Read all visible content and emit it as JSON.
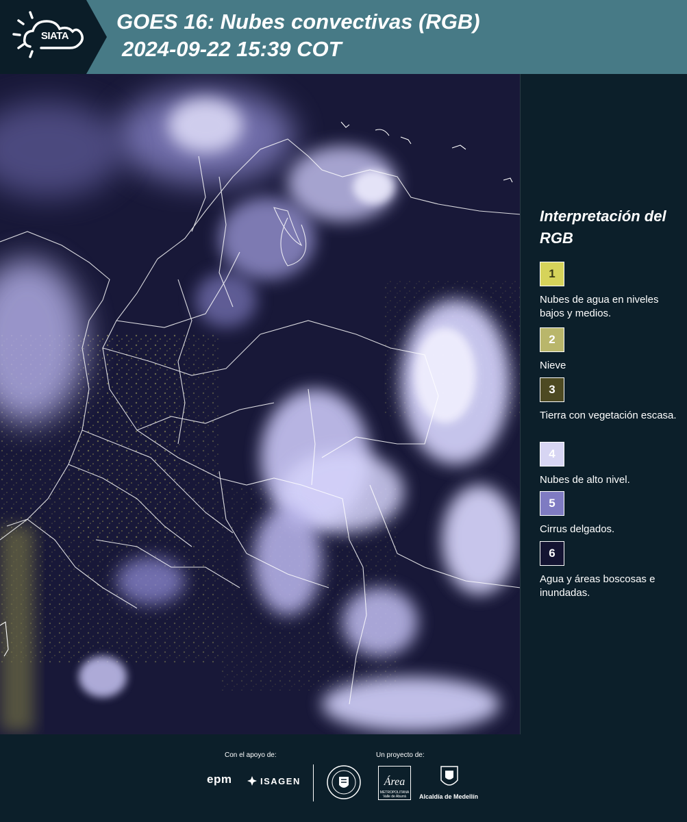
{
  "header": {
    "logo_text": "SIATA",
    "title_line1": "GOES 16: Nubes convectivas (RGB)",
    "title_line2": "2024-09-22 15:39 COT"
  },
  "map": {
    "layer": "Nubes convectivas (RGB)",
    "colors": {
      "background": "#181838",
      "high_cloud": "#c9c6f5",
      "cloud_core": "#ecebff",
      "low_cloud": "#b7b366",
      "boundaries": "#ffffff"
    }
  },
  "legend": {
    "title": "Interpretación del RGB",
    "items": [
      {
        "number": "1",
        "label": "Nubes de agua en niveles bajos y medios.",
        "color": "#d6d35a",
        "text_color": "#3a3a14"
      },
      {
        "number": "2",
        "label": "Nieve",
        "color": "#b9b66b",
        "text_color": "#ffffff"
      },
      {
        "number": "3",
        "label": "Tierra con vegetación escasa.",
        "color": "#4d4a22",
        "text_color": "#ffffff"
      },
      {
        "number": "4",
        "label": "Nubes de alto nivel.",
        "color": "#d7d5f3",
        "text_color": "#ffffff"
      },
      {
        "number": "5",
        "label": "Cirrus delgados.",
        "color": "#7f7bc2",
        "text_color": "#ffffff"
      },
      {
        "number": "6",
        "label": "Agua y áreas boscosas e inundadas.",
        "color": "#141432",
        "text_color": "#ffffff"
      }
    ]
  },
  "footer": {
    "support_label": "Con el apoyo de:",
    "project_label": "Un proyecto de:",
    "sponsors": [
      "epm",
      "ISAGEN"
    ],
    "partners": [
      "Área Metropolitana Valle de Aburrá",
      "Alcaldía de Medellín"
    ],
    "alcaldia_text": "Alcaldía de Medellín",
    "area_name": "Área",
    "area_subtitle": "METROPOLITANA",
    "area_subtitle2": "Valle de Aburrá"
  }
}
